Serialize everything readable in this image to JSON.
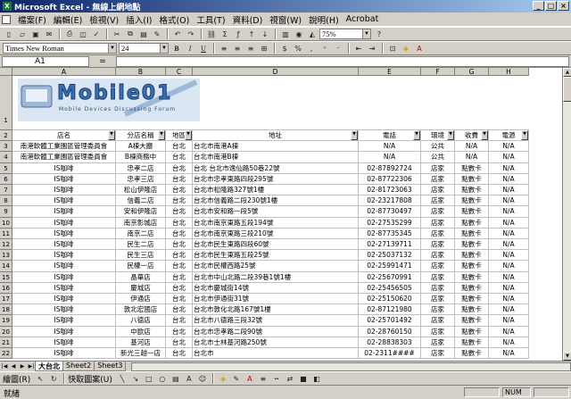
{
  "window": {
    "title": "Microsoft Excel - 無線上網地點"
  },
  "menu": [
    "檔案(F)",
    "編輯(E)",
    "檢視(V)",
    "插入(I)",
    "格式(O)",
    "工具(T)",
    "資料(D)",
    "視窗(W)",
    "說明(H)",
    "Acrobat"
  ],
  "toolbar": {
    "zoom": "75%",
    "font_name": "Times New Roman",
    "font_size": "24",
    "bold": "B",
    "italic": "I",
    "underline": "U",
    "currency": "$",
    "percent": "%",
    "comma": ","
  },
  "formula_bar": {
    "cell_ref": "A1",
    "equals": "="
  },
  "columns": [
    "A",
    "B",
    "C",
    "D",
    "E",
    "F",
    "G",
    "H"
  ],
  "logo": {
    "text": "Mobile01",
    "subtitle": "Mobile Devices Discussing Forum"
  },
  "headers": [
    "店名",
    "分店名稱",
    "地區",
    "地址",
    "電話",
    "環境",
    "收費",
    "電源"
  ],
  "rows": [
    {
      "n": "3",
      "c": [
        "南港軟體工業園區管理委員會",
        "A棟大廳",
        "台北",
        "台北市南港A棟",
        "N/A",
        "公共",
        "N/A",
        "N/A"
      ]
    },
    {
      "n": "4",
      "c": [
        "南港軟體工業園區管理委員會",
        "B棟商務中",
        "台北",
        "台北市南港B棟",
        "N/A",
        "公共",
        "N/A",
        "N/A"
      ]
    },
    {
      "n": "5",
      "c": [
        "IS咖啡",
        "忠孝二店",
        "台北",
        "台北 台北市逸仙路50巷22號",
        "02-87892724",
        "店家",
        "點數卡",
        "N/A"
      ]
    },
    {
      "n": "6",
      "c": [
        "IS咖啡",
        "忠孝三店",
        "台北",
        "台北市忠孝東路四段295號",
        "02-87722306",
        "店家",
        "點數卡",
        "N/A"
      ]
    },
    {
      "n": "7",
      "c": [
        "IS咖啡",
        "松山伊隆店",
        "台北",
        "台北市松隆路327號1樓",
        "02-81723063",
        "店家",
        "點數卡",
        "N/A"
      ]
    },
    {
      "n": "8",
      "c": [
        "IS咖啡",
        "信義二店",
        "台北",
        "台北市信義路二段230號1樓",
        "02-23217808",
        "店家",
        "點數卡",
        "N/A"
      ]
    },
    {
      "n": "9",
      "c": [
        "IS咖啡",
        "安和伊隆店",
        "台北",
        "台北市安和路一段5號",
        "02-87730497",
        "店家",
        "點數卡",
        "N/A"
      ]
    },
    {
      "n": "10",
      "c": [
        "IS咖啡",
        "南京影城店",
        "台北",
        "台北市南京東路五段194號",
        "02-27535299",
        "店家",
        "點數卡",
        "N/A"
      ]
    },
    {
      "n": "11",
      "c": [
        "IS咖啡",
        "南京二店",
        "台北",
        "台北市南京東路三段210號",
        "02-87735345",
        "店家",
        "點數卡",
        "N/A"
      ]
    },
    {
      "n": "12",
      "c": [
        "IS咖啡",
        "民生二店",
        "台北",
        "台北市民生東路四段60號",
        "02-27139711",
        "店家",
        "點數卡",
        "N/A"
      ]
    },
    {
      "n": "13",
      "c": [
        "IS咖啡",
        "民生三店",
        "台北",
        "台北市民生東路五段25號",
        "02-25037132",
        "店家",
        "點數卡",
        "N/A"
      ]
    },
    {
      "n": "14",
      "c": [
        "IS咖啡",
        "民權一店",
        "台北",
        "台北市民權西路25號",
        "02-25991471",
        "店家",
        "點數卡",
        "N/A"
      ]
    },
    {
      "n": "15",
      "c": [
        "IS咖啡",
        "晶華店",
        "台北",
        "台北市中山北路二段39巷1號1樓",
        "02-25670991",
        "店家",
        "點數卡",
        "N/A"
      ]
    },
    {
      "n": "16",
      "c": [
        "IS咖啡",
        "慶城店",
        "台北",
        "台北市慶城街14號",
        "02-25456505",
        "店家",
        "點數卡",
        "N/A"
      ]
    },
    {
      "n": "17",
      "c": [
        "IS咖啡",
        "伊通店",
        "台北",
        "台北市伊通街31號",
        "02-25150620",
        "店家",
        "點數卡",
        "N/A"
      ]
    },
    {
      "n": "18",
      "c": [
        "IS咖啡",
        "敦北宏國店",
        "台北",
        "台北市敦化北路167號1樓",
        "02-87121980",
        "店家",
        "點數卡",
        "N/A"
      ]
    },
    {
      "n": "19",
      "c": [
        "IS咖啡",
        "八德店",
        "台北",
        "台北市八德路三段32號",
        "02-25701492",
        "店家",
        "點數卡",
        "N/A"
      ]
    },
    {
      "n": "20",
      "c": [
        "IS咖啡",
        "中歐店",
        "台北",
        "台北市忠孝路二段90號",
        "02-28760150",
        "店家",
        "點數卡",
        "N/A"
      ]
    },
    {
      "n": "21",
      "c": [
        "IS咖啡",
        "基河店",
        "台北",
        "台北市士林基河路250號",
        "02-28838303",
        "店家",
        "點數卡",
        "N/A"
      ]
    },
    {
      "n": "22",
      "c": [
        "IS咖啡",
        "新光三越一店",
        "台北",
        "台北市",
        "02-2311####",
        "店家",
        "點數卡",
        "N/A"
      ]
    }
  ],
  "sheets": [
    "大台北",
    "Sheet2",
    "Sheet3"
  ],
  "drawing": {
    "draw_label": "繪圖(R)",
    "autoshape_label": "快取圖案(U)"
  },
  "status": {
    "ready": "就緒",
    "num": "NUM"
  }
}
